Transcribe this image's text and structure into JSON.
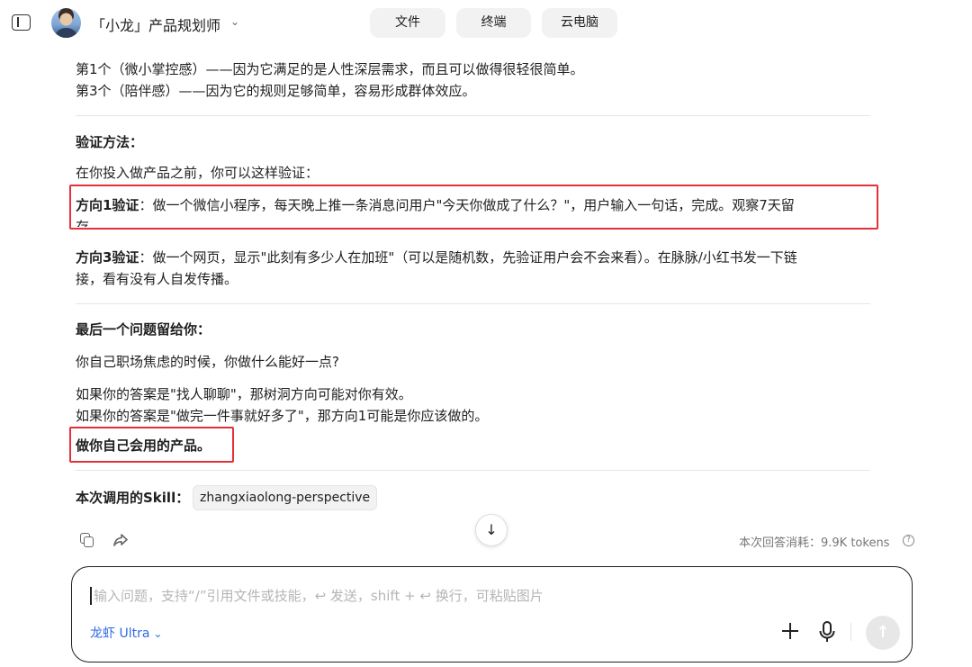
{
  "header": {
    "assistant_name": "「小龙」产品规划师",
    "tabs": [
      "文件",
      "终端",
      "云电脑"
    ]
  },
  "content": {
    "line1": "第1个（微小掌控感）——因为它满足的是人性深层需求，而且可以做得很轻很简单。",
    "line2": "第3个（陪伴感）——因为它的规则足够简单，容易形成群体效应。",
    "validation_heading": "验证方法：",
    "validation_intro": "在你投入做产品之前，你可以这样验证：",
    "dir1_label": "方向1验证",
    "dir1_text_a": "：做一个微信小程序，每天晚上推一条消息问用户\"今天你做成了什么？\"，用户输入一句话，完成。观察7天留",
    "dir1_text_b": "存。",
    "dir3_label": "方向3验证",
    "dir3_text_a": "：做一个网页，显示\"此刻有多少人在加班\"（可以是随机数，先验证用户会不会来看）。在脉脉/小红书发一下链",
    "dir3_text_b": "接，看有没有人自发传播。",
    "last_question_heading": "最后一个问题留给你：",
    "question": "你自己职场焦虑的时候，你做什么能好一点?",
    "answer1": "如果你的答案是\"找人聊聊\"，那树洞方向可能对你有效。",
    "answer2": "如果你的答案是\"做完一件事就好多了\"，那方向1可能是你应该做的。",
    "conclusion": "做你自己会用的产品。",
    "skill_label": "本次调用的Skill：",
    "skill_name": "zhangxiaolong-perspective"
  },
  "actions": {
    "token_usage": "本次回答消耗：9.9K tokens"
  },
  "input": {
    "placeholder": "输入问题，支持“/”引用文件或技能，↩ 发送，shift + ↩ 换行，可粘贴图片",
    "model": "龙虾 Ultra"
  },
  "colors": {
    "highlight": "#e4303a",
    "accent": "#2f6ae6"
  },
  "icons": [
    "sidebar-toggle-icon",
    "chevron-down-icon",
    "copy-icon",
    "share-icon",
    "arrow-down-icon",
    "help-icon",
    "plus-icon",
    "microphone-icon",
    "send-arrow-icon"
  ]
}
